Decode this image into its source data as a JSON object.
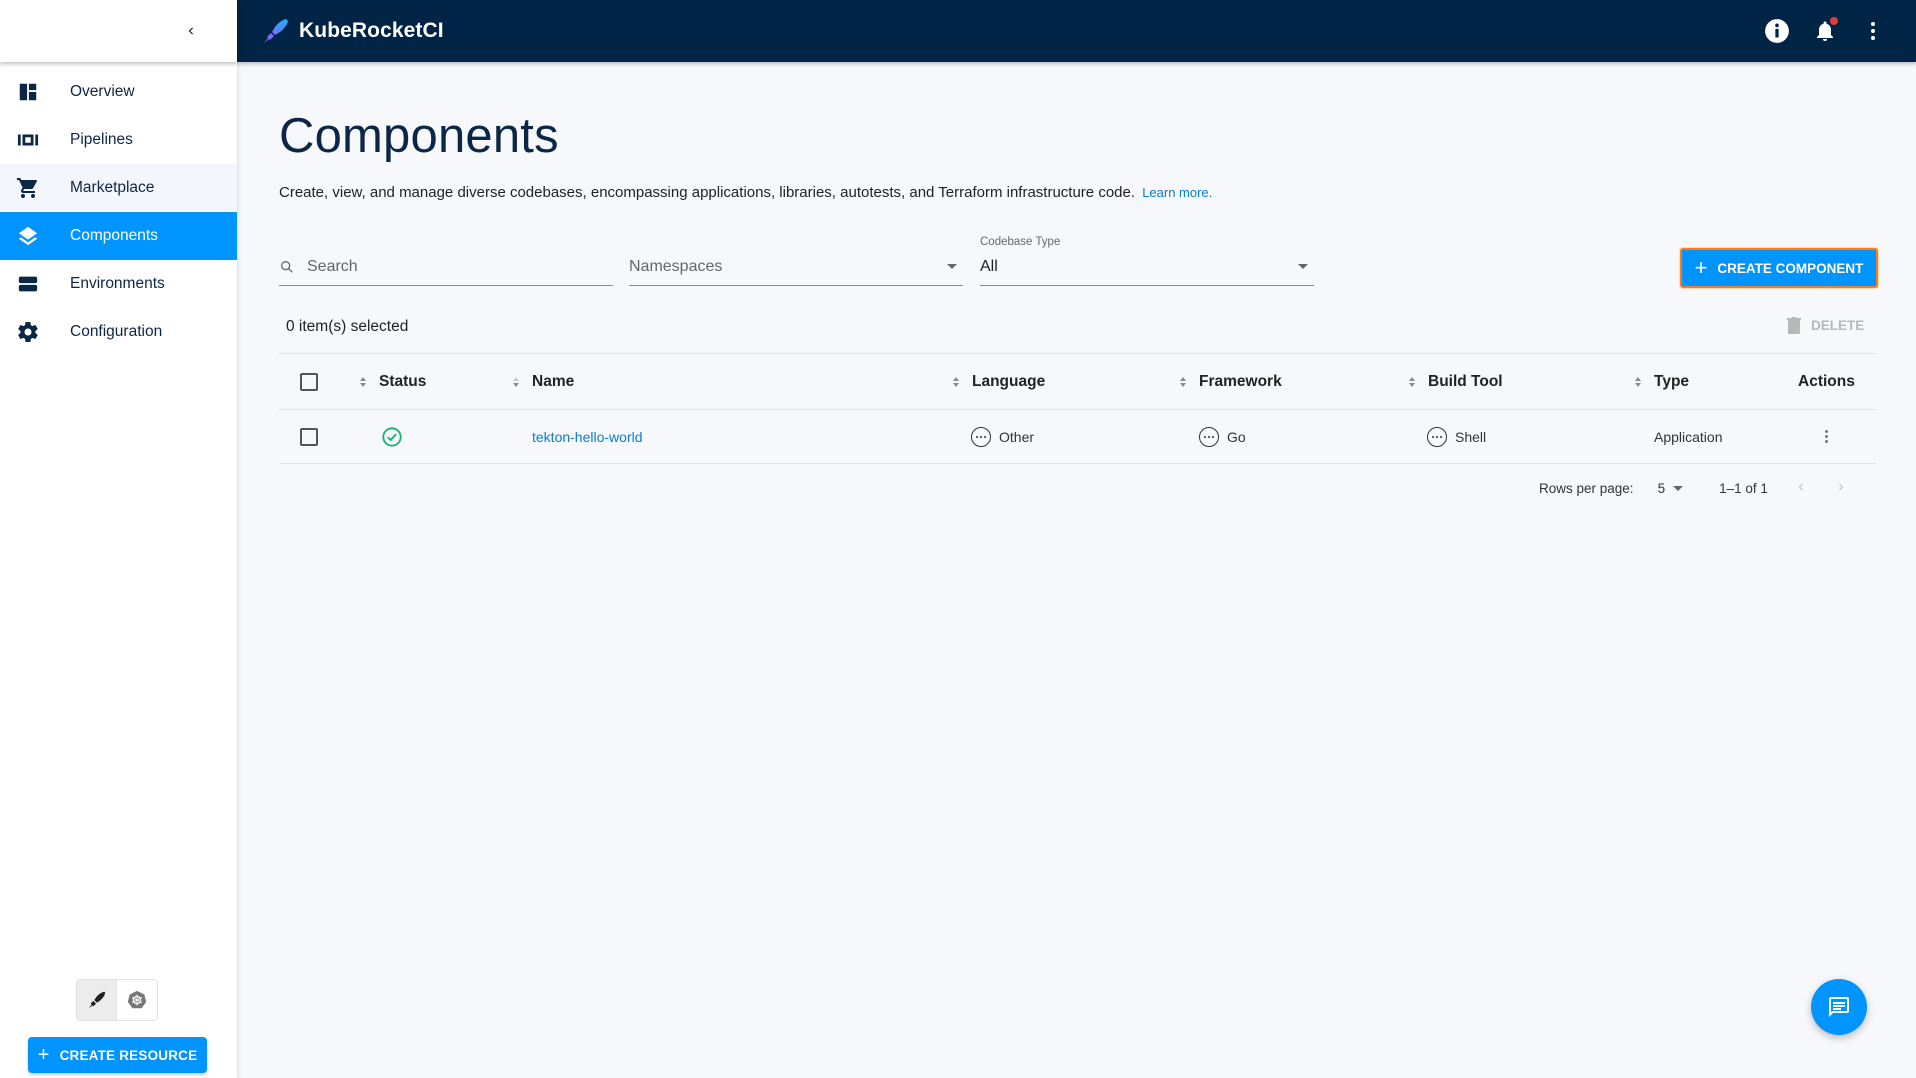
{
  "app": {
    "brand_name": "KubeRocketCI",
    "colors": {
      "header_bg": "#002446",
      "accent": "#0094ff",
      "focus_outline": "#ff7a1a",
      "nav_text": "#0c2646",
      "link": "#0c7bd0",
      "success": "#18b26b",
      "notification_dot": "#e53935"
    }
  },
  "header": {
    "icons": [
      "info-icon",
      "notifications-bell-icon",
      "more-vertical-icon"
    ],
    "has_unread_notifications": true
  },
  "sidebar": {
    "collapse_icon": "chevron-left-icon",
    "items": [
      {
        "label": "Overview",
        "icon": "dashboard-icon",
        "active": false
      },
      {
        "label": "Pipelines",
        "icon": "pipelines-icon",
        "active": false
      },
      {
        "label": "Marketplace",
        "icon": "cart-icon",
        "active": false,
        "hovered": true
      },
      {
        "label": "Components",
        "icon": "layers-icon",
        "active": true
      },
      {
        "label": "Environments",
        "icon": "environments-icon",
        "active": false
      },
      {
        "label": "Configuration",
        "icon": "gear-icon",
        "active": false
      }
    ],
    "mode_switch": [
      {
        "icon": "rocket-icon",
        "selected": true
      },
      {
        "icon": "kubernetes-icon",
        "selected": false
      }
    ],
    "create_resource_label": "CREATE RESOURCE"
  },
  "page": {
    "title": "Components",
    "description": "Create, view, and manage diverse codebases, encompassing applications, libraries, autotests, and Terraform infrastructure code.",
    "learn_more": "Learn more."
  },
  "filters": {
    "search_placeholder": "Search",
    "namespaces_placeholder": "Namespaces",
    "codebase_type_label": "Codebase Type",
    "codebase_type_value": "All"
  },
  "toolbar": {
    "create_component_label": "CREATE COMPONENT",
    "selected_count": "0 item(s) selected",
    "delete_label": "DELETE"
  },
  "table": {
    "columns": [
      "Status",
      "Name",
      "Language",
      "Framework",
      "Build Tool",
      "Type",
      "Actions"
    ],
    "rows": [
      {
        "status": "success",
        "name": "tekton-hello-world",
        "language": "Other",
        "framework": "Go",
        "build_tool": "Shell",
        "type": "Application"
      }
    ]
  },
  "pagination": {
    "rows_per_page_label": "Rows per page:",
    "rows_per_page": "5",
    "range": "1–1 of 1"
  },
  "fab": {
    "icon": "chat-icon"
  }
}
